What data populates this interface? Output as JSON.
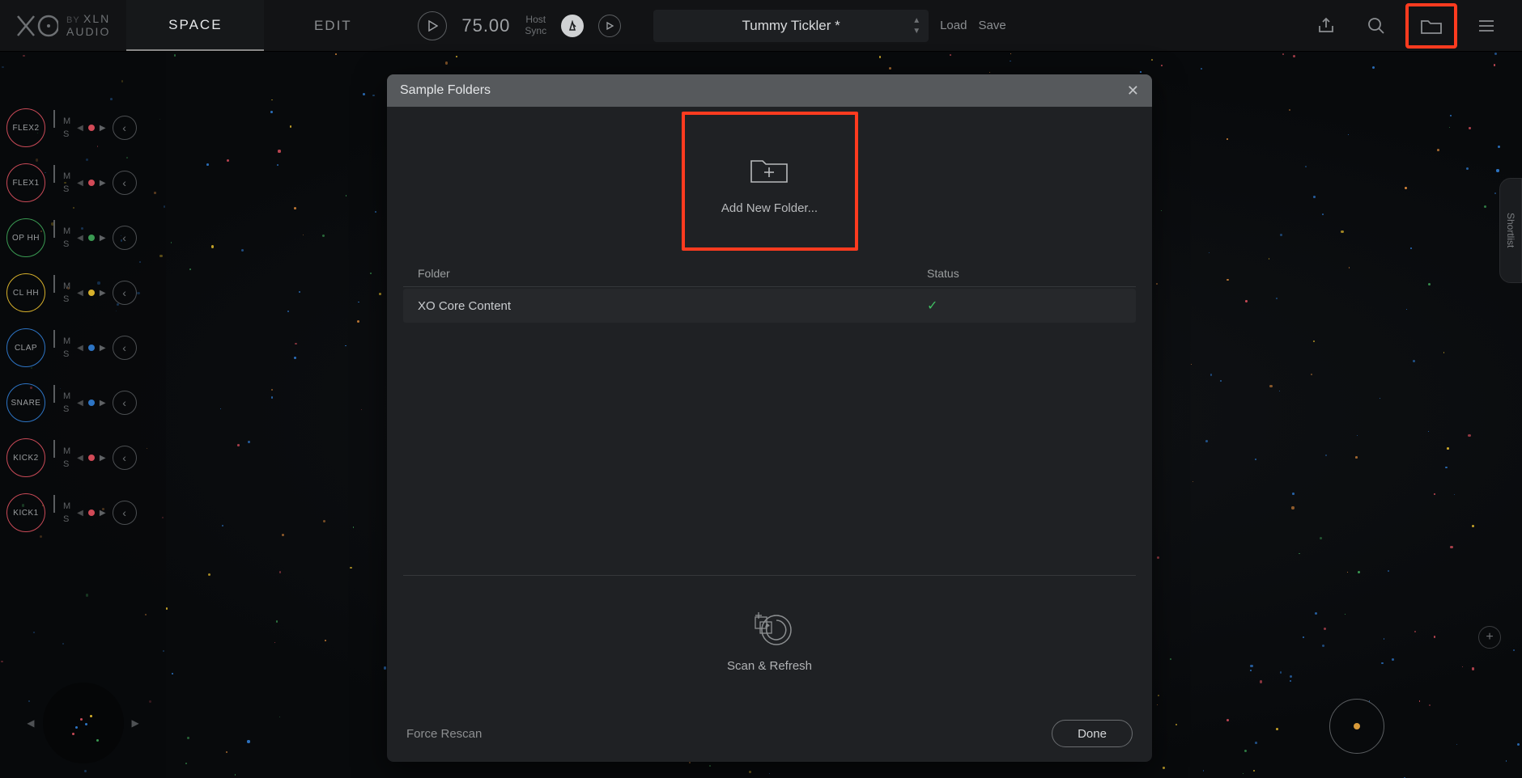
{
  "brand": {
    "by": "BY",
    "l2": "XLN",
    "l3": "AUDIO"
  },
  "tabs": {
    "space": "SPACE",
    "edit": "EDIT"
  },
  "transport": {
    "tempo": "75.00",
    "host": "Host",
    "sync": "Sync"
  },
  "preset": {
    "name": "Tummy Tickler *"
  },
  "load_save": {
    "load": "Load",
    "save": "Save"
  },
  "channels": [
    {
      "label": "FLEX2",
      "color": "#c94a57",
      "dot": "#d14a57"
    },
    {
      "label": "FLEX1",
      "color": "#c94a57",
      "dot": "#d14a57"
    },
    {
      "label": "OP HH",
      "color": "#3a9a52",
      "dot": "#3a9a52"
    },
    {
      "label": "CL HH",
      "color": "#d6b02b",
      "dot": "#d6b02b"
    },
    {
      "label": "CLAP",
      "color": "#2d74c4",
      "dot": "#2d74c4"
    },
    {
      "label": "SNARE",
      "color": "#2d74c4",
      "dot": "#2d74c4"
    },
    {
      "label": "KICK2",
      "color": "#c94a57",
      "dot": "#d14a57"
    },
    {
      "label": "KICK1",
      "color": "#c94a57",
      "dot": "#d14a57"
    }
  ],
  "ms": {
    "m": "M",
    "s": "S"
  },
  "shortlist": "Shortlist",
  "modal": {
    "title": "Sample Folders",
    "add_new": "Add New Folder...",
    "col_folder": "Folder",
    "col_status": "Status",
    "rows": [
      {
        "name": "XO Core Content",
        "status_ok": true
      }
    ],
    "scan": "Scan & Refresh",
    "force": "Force Rescan",
    "done": "Done"
  }
}
